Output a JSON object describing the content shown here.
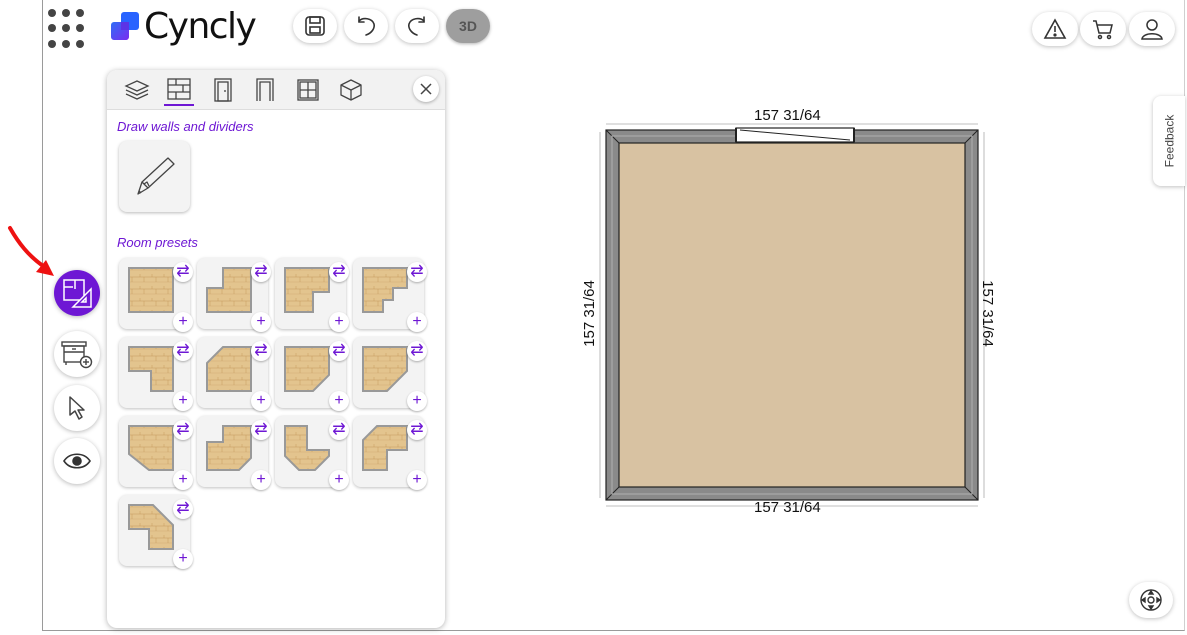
{
  "app": {
    "name": "Cyncly",
    "btn_3d": "3D"
  },
  "colors": {
    "accent": "#6e17d4",
    "floor": "#d8c2a2",
    "wall": "#8a8a8a"
  },
  "panel": {
    "draw_section_title": "Draw walls and dividers",
    "presets_title": "Room presets",
    "tabs": [
      "layers-icon",
      "walls-icon",
      "door-icon",
      "opening-icon",
      "window-icon",
      "box-icon"
    ]
  },
  "feedback_label": "Feedback",
  "room": {
    "top_dimension": "157 31/64",
    "bottom_dimension": "157 31/64",
    "left_dimension": "157 31/64",
    "right_dimension": "157 31/64"
  }
}
